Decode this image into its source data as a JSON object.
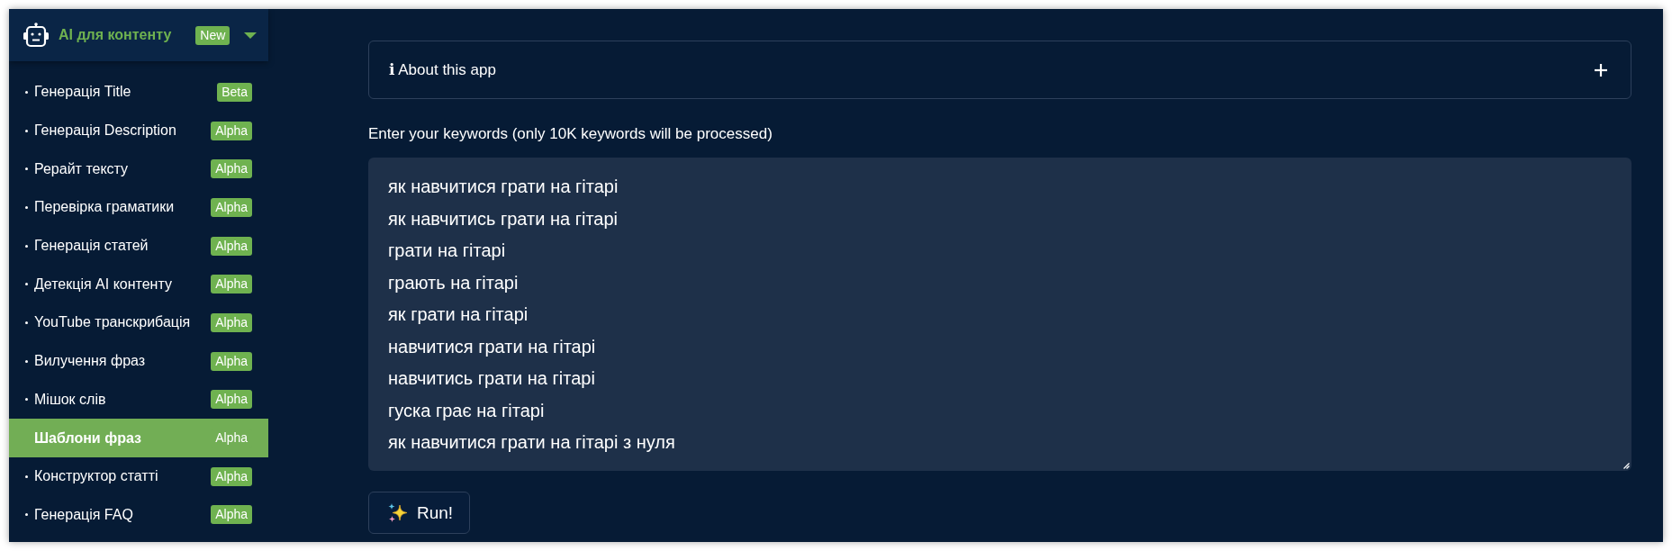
{
  "sidebar": {
    "header": {
      "title": "AI для контенту",
      "badge": "New",
      "expanded": true
    },
    "items": [
      {
        "label": "Генерація Title",
        "badge": "Beta",
        "selected": false
      },
      {
        "label": "Генерація Description",
        "badge": "Alpha",
        "selected": false
      },
      {
        "label": "Рерайт тексту",
        "badge": "Alpha",
        "selected": false
      },
      {
        "label": "Перевірка граматики",
        "badge": "Alpha",
        "selected": false
      },
      {
        "label": "Генерація статей",
        "badge": "Alpha",
        "selected": false
      },
      {
        "label": "Детекція AI контенту",
        "badge": "Alpha",
        "selected": false
      },
      {
        "label": "YouTube транскрибація",
        "badge": "Alpha",
        "selected": false
      },
      {
        "label": "Вилучення фраз",
        "badge": "Alpha",
        "selected": false
      },
      {
        "label": "Мішок слів",
        "badge": "Alpha",
        "selected": false
      },
      {
        "label": "Шаблони фраз",
        "badge": "Alpha",
        "selected": true
      },
      {
        "label": "Конструктор статті",
        "badge": "Alpha",
        "selected": false
      },
      {
        "label": "Генерація FAQ",
        "badge": "Alpha",
        "selected": false
      }
    ]
  },
  "main": {
    "about": {
      "label": "ℹ About this app",
      "expanded": false
    },
    "keywords": {
      "label": "Enter your keywords (only 10K keywords will be processed)",
      "value": [
        "як навчитися грати на гітарі",
        "як навчитись грати на гітарі",
        "грати на гітарі",
        "грають на гітарі",
        "як грати на гітарі",
        "навчитися грати на гітарі",
        "навчитись грати на гітарі",
        "гуска грає на гітарі",
        "як навчитися грати на гітарі з нуля"
      ]
    },
    "run_button": {
      "label": "Run!"
    }
  }
}
